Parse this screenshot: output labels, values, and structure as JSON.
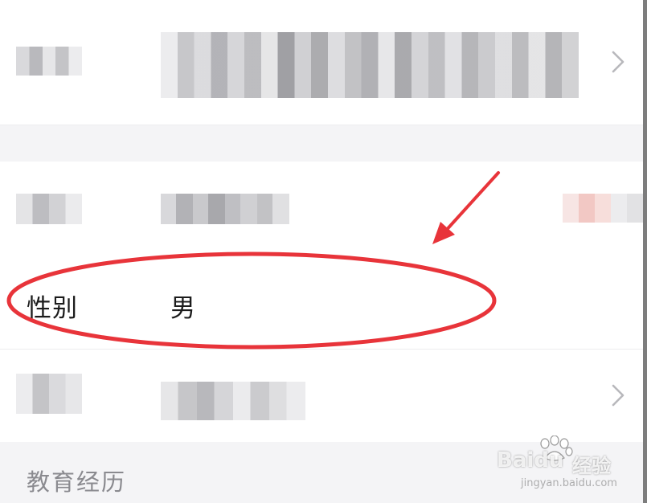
{
  "gender_row": {
    "label": "性别",
    "value": "男"
  },
  "education": {
    "section_title": "教育经历"
  },
  "annotations": {
    "highlight_color": "#e8343a"
  },
  "watermark": {
    "brand": "Baidu",
    "brand_cn": "经验",
    "url": "jingyan.baidu.com"
  },
  "icons": {
    "chevron": "chevron-right-icon",
    "arrow": "annotation-arrow",
    "ellipse": "annotation-ellipse"
  },
  "colors": {
    "background": "#f4f4f6",
    "row": "#ffffff",
    "text": "#1c1c1c",
    "muted": "#8a8a8f",
    "chevron": "#b8b8bc"
  }
}
